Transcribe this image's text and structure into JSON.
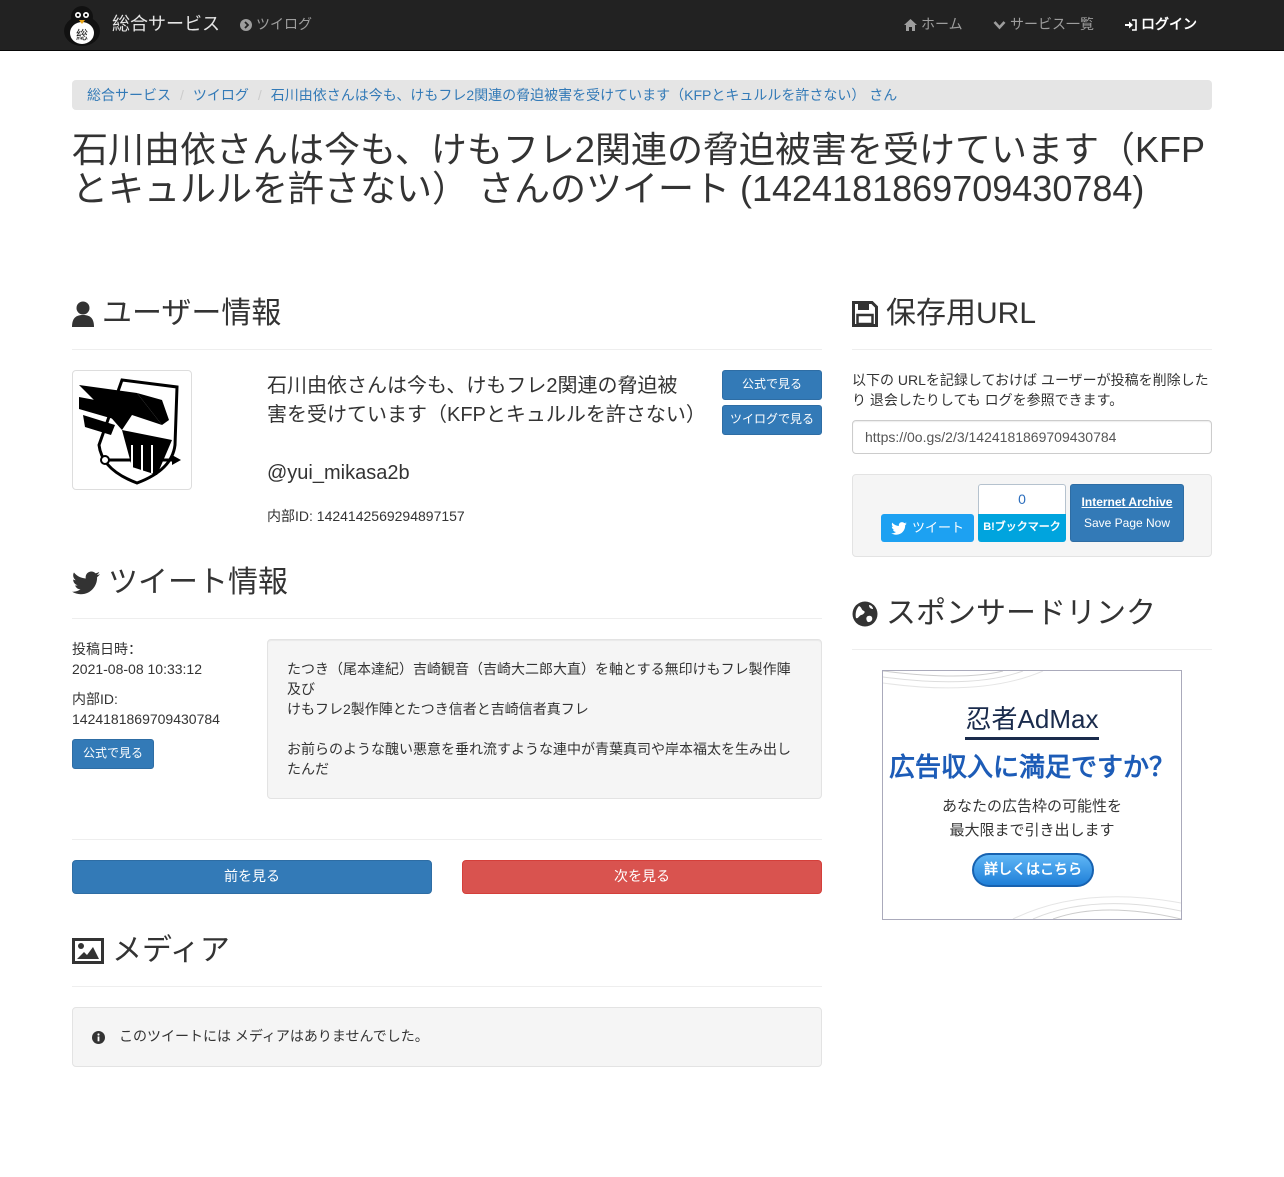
{
  "navbar": {
    "brand": "総合サービス",
    "brand_logo_char": "総",
    "link_tweet_log": "ツイログ",
    "link_home": "ホーム",
    "link_services": "サービス一覧",
    "link_login": "ログイン"
  },
  "breadcrumb": {
    "items": [
      "総合サービス",
      "ツイログ",
      "石川由依さんは今も、けもフレ2関連の脅迫被害を受けています（KFPとキュルルを許さない） さん"
    ]
  },
  "page": {
    "title": "石川由依さんは今も、けもフレ2関連の脅迫被害を受けています（KFPとキュルルを許さない） さんのツイート (1424181869709430784)"
  },
  "user_section": {
    "heading": "ユーザー情報",
    "name": "石川由依さんは今も、けもフレ2関連の脅迫被害を受けています（KFPとキュルルを許さない）",
    "handle": "@yui_mikasa2b",
    "internal_id": "内部ID: 1424142569294897157",
    "btn_official": "公式で見る",
    "btn_tweetlog": "ツイログで見る"
  },
  "tweet_section": {
    "heading": "ツイート情報",
    "posted_label": "投稿日時：",
    "posted_value": "2021-08-08 10:33:12",
    "id_label": "内部ID:",
    "id_value": "1424181869709430784",
    "btn_official": "公式で見る",
    "text_line1": "たつき（尾本達紀）吉崎観音（吉崎大二郎大直）を軸とする無印けもフレ製作陣及び",
    "text_line2": "けもフレ2製作陣とたつき信者と吉崎信者真フレ",
    "text_line3": "お前らのような醜い悪意を垂れ流すような連中が青葉真司や岸本福太を生み出したんだ"
  },
  "pager": {
    "prev": "前を見る",
    "next": "次を見る"
  },
  "media_section": {
    "heading": "メディア",
    "empty_message": "このツイートには メディアはありませんでした。"
  },
  "save_section": {
    "heading": "保存用URL",
    "description": "以下の URLを記録しておけば ユーザーが投稿を削除したり 退会したりしても ログを参照できます。",
    "url": "https://0o.gs/2/3/1424181869709430784",
    "tweet_button": "ツイート",
    "hatena_count": "0",
    "hatena_button": "B!ブックマーク",
    "ia_title": "Internet Archive",
    "ia_sub": "Save Page Now"
  },
  "sponsor_section": {
    "heading": "スポンサードリンク",
    "ad_logo": "忍者AdMax",
    "ad_headline": "広告収入に満足ですか？",
    "ad_sub1": "あなたの広告枠の可能性を",
    "ad_sub2": "最大限まで引き出します",
    "ad_button": "詳しくはこちら"
  },
  "colors": {
    "navbar_bg": "#222222",
    "primary": "#337ab7",
    "danger": "#d9534f",
    "twitter": "#1da1f2",
    "hatena": "#00a4de"
  },
  "icons": {
    "brand": "penguin-logo-icon",
    "tweet_log": "chevron-circle-icon",
    "home": "home-icon",
    "services": "chevron-down-icon",
    "login": "sign-in-icon",
    "user": "user-icon",
    "save": "floppy-disk-icon",
    "twitter": "twitter-bird-icon",
    "globe": "globe-icon",
    "media": "picture-icon",
    "info": "info-circle-icon"
  }
}
